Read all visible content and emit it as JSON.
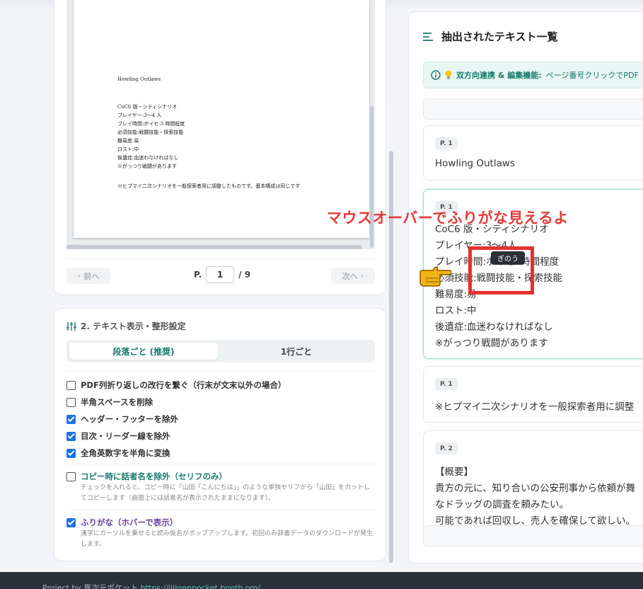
{
  "pdf": {
    "lines": [
      "Howling Outlaws",
      "CoC6 版・シティシナリオ",
      "プレイヤー:3～4 人",
      "プレイ時間:ボイセ 3 時間程度",
      "必須技能:戦闘技能・探索技能",
      "難易度:易",
      "ロスト:中",
      "後遺症:血迷わなければなし",
      "※がっつり戦闘があります",
      "※ヒプマイ二次シナリオを一般探索者用に調整したものです。基本構成は同じです"
    ]
  },
  "pager": {
    "prev_label": "前へ",
    "next_label": "次へ",
    "page_prefix": "P.",
    "current_page": "1",
    "total": "/ 9"
  },
  "settings": {
    "title": "2. テキスト表示・整形設定",
    "seg_a": "段落ごと (推奨)",
    "seg_b": "1行ごと",
    "options": [
      {
        "label": "PDF列折り返しの改行を繋ぐ（行末が文末以外の場合）",
        "checked": false
      },
      {
        "label": "半角スペースを削除",
        "checked": false
      },
      {
        "label": "ヘッダー・フッターを除外",
        "checked": true
      },
      {
        "label": "目次・リーダー線を除外",
        "checked": true
      },
      {
        "label": "全角英数字を半角に変換",
        "checked": true
      }
    ],
    "speaker_label": "コピー時に話者名を除外（セリフのみ）",
    "speaker_note": "チェックを入れると、コピー時に「山田「こんにちは」」のような単独セリフから「山田」をカットしてコピーします（画面上には話者名が表示されたままになります）。",
    "furigana_label": "ふりがな（ホバーで表示）",
    "furigana_note": "漢字にカーソルを乗せると読み仮名がポップアップします。初回のみ辞書データのダウンロードが発生します。"
  },
  "right": {
    "title": "抽出されたテキスト一覧",
    "info_strong": "双方向連携 & 編集機能:",
    "info_rest": "ページ番号クリックでPDF",
    "cards": [
      {
        "badge": "P. 1",
        "lines": [
          "Howling Outlaws"
        ]
      },
      {
        "badge": "P. 1",
        "lines": [
          "CoC6 版・シティシナリオ",
          "プレイヤー:3〜4人",
          "プレイ時間:ボイセ3時間程度",
          "必須技能:戦闘技能・探索技能",
          "難易度:易",
          "ロスト:中",
          "後遺症:血迷わなければなし",
          "※がっつり戦闘があります"
        ]
      },
      {
        "badge": "P. 1",
        "lines": [
          "※ヒプマイ二次シナリオを一般探索者用に調整"
        ]
      },
      {
        "badge": "P. 2",
        "lines": [
          "【概要】",
          "貴方の元に、知り合いの公安刑事から依頼が舞",
          "なドラッグの調査を頼みたい。",
          "可能であれば回収し、売人を確保して欲しい。"
        ]
      }
    ]
  },
  "overlay": {
    "caption": "マウスオーバーでふりがな見えるよ",
    "tooltip": "ぎのう"
  },
  "footer": {
    "prefix": "Project by 異次元ポケット ",
    "link": "https://jijigenpocket.booth.pm/"
  },
  "colors": {
    "accent": "#187a6e",
    "checkbox": "#1a73e8",
    "annotation": "#e53030"
  }
}
